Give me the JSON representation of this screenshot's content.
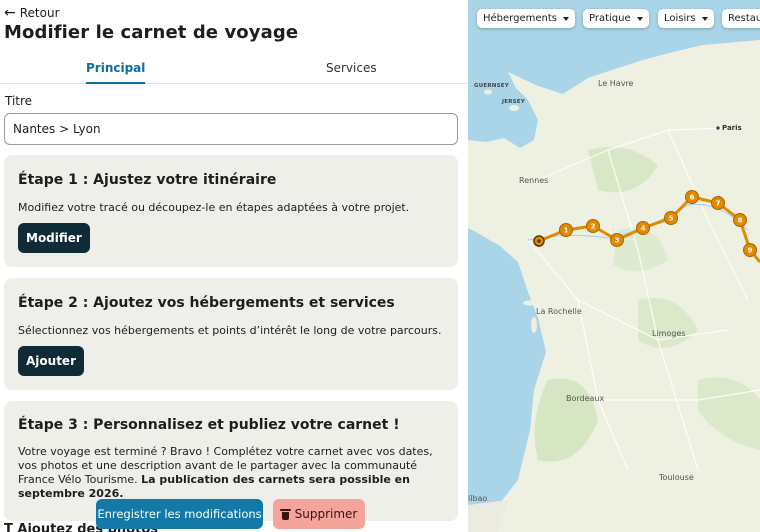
{
  "header": {
    "back_label": "Retour",
    "title": "Modifier le carnet de voyage"
  },
  "tabs": [
    {
      "label": "Principal",
      "active": true
    },
    {
      "label": "Services",
      "active": false
    }
  ],
  "title_field": {
    "label": "Titre",
    "value": "Nantes > Lyon"
  },
  "steps": [
    {
      "title": "Étape 1 : Ajustez votre itinéraire",
      "text": "Modifiez votre tracé ou découpez-le en étapes adaptées à votre projet.",
      "button": "Modifier"
    },
    {
      "title": "Étape 2 : Ajoutez vos hébergements et services",
      "text": "Sélectionnez vos hébergements et points d’intérêt le long de votre parcours.",
      "button": "Ajouter"
    },
    {
      "title": "Étape 3 : Personnalisez et publiez votre carnet !",
      "text": "Votre voyage est terminé ? Bravo ! Complétez votre carnet avec vos dates, vos photos et une description avant de le partager avec la communauté France Vélo Tourisme.",
      "text_bold": "La publication des carnets sera possible en septembre 2026."
    }
  ],
  "actions": {
    "save_label": "Enregistrer les modifications",
    "delete_label": "Supprimer"
  },
  "below_peek": "T  Ajoutez des photos",
  "map": {
    "filters": [
      "Hébergements",
      "Pratique",
      "Loisirs",
      "Restau"
    ],
    "labels": {
      "guernsey": "GUERNSEY",
      "jersey": "JERSEY",
      "le_havre": "Le Havre",
      "paris": "Paris",
      "rennes": "Rennes",
      "la_rochelle": "La Rochelle",
      "limoges": "Limoges",
      "bordeaux": "Bordeaux",
      "toulouse": "Toulouse",
      "bilbao": "ilbao"
    },
    "route_markers": [
      "1",
      "2",
      "3",
      "4",
      "5",
      "6",
      "7",
      "8",
      "9"
    ],
    "colors": {
      "route": "#e08a00",
      "land": "#eef0e2",
      "sea": "#aad5e8",
      "forest": "#cfe3bb"
    }
  }
}
